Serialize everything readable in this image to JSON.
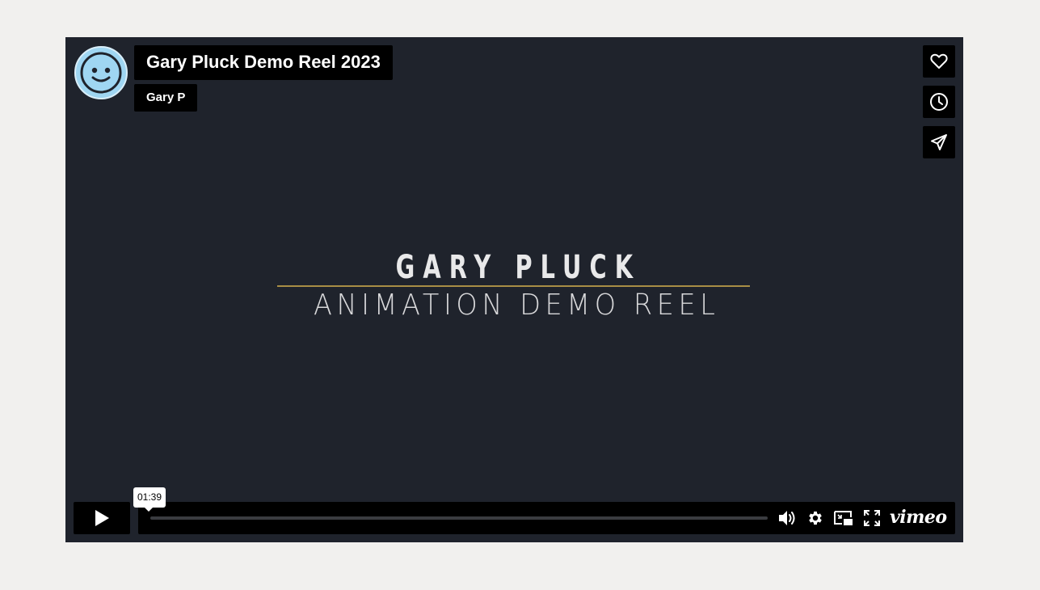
{
  "video": {
    "title": "Gary Pluck Demo Reel 2023",
    "author": "Gary P",
    "frame_title_line1": "GARY PLUCK",
    "frame_title_line2": "ANIMATION DEMO REEL",
    "accent_rule_color": "#a88e45",
    "background_color": "#1f232c"
  },
  "side_actions": [
    {
      "name": "like",
      "icon": "heart-icon"
    },
    {
      "name": "watch-later",
      "icon": "clock-icon"
    },
    {
      "name": "share",
      "icon": "paper-plane-icon"
    }
  ],
  "controls": {
    "time_tooltip": "01:39",
    "progress": 0,
    "play_icon": "play-icon",
    "volume_icon": "volume-icon",
    "settings_icon": "gear-icon",
    "pip_icon": "picture-in-picture-icon",
    "fullscreen_icon": "fullscreen-icon",
    "brand_logo": "vimeo"
  }
}
